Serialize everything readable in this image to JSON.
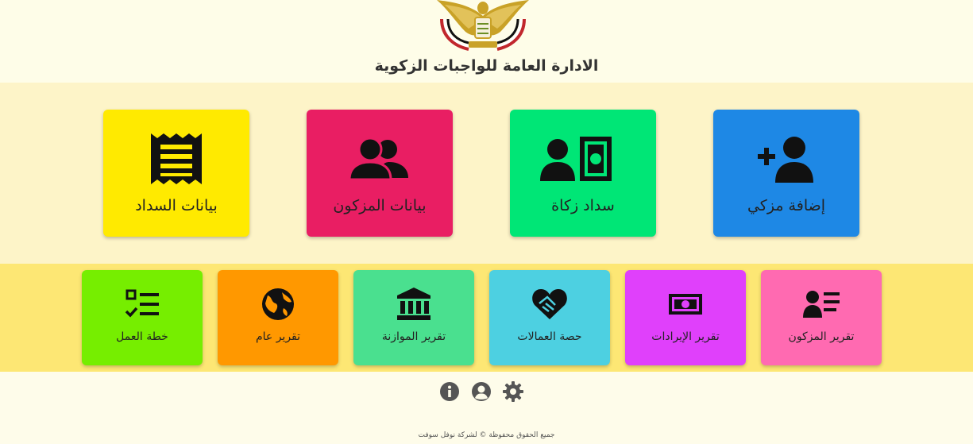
{
  "header": {
    "title": "الادارة العامة للواجبات الزكوية"
  },
  "main_tiles": [
    {
      "label": "إضافة مزكي",
      "icon": "user-plus-icon",
      "color": "#1e88e5"
    },
    {
      "label": "سداد زكاة",
      "icon": "user-money-icon",
      "color": "#00e676"
    },
    {
      "label": "بيانات المزكون",
      "icon": "users-icon",
      "color": "#e91e63"
    },
    {
      "label": "بيانات السداد",
      "icon": "receipt-icon",
      "color": "#ffea00"
    }
  ],
  "report_tiles": [
    {
      "label": "تقرير المزكون",
      "icon": "address-card-icon",
      "color": "#ff6ab1"
    },
    {
      "label": "تقرير الإيرادات",
      "icon": "money-bill-icon",
      "color": "#e040fb"
    },
    {
      "label": "حصة العمالات",
      "icon": "handshake-heart-icon",
      "color": "#4dd0e1"
    },
    {
      "label": "تقرير الموازنة",
      "icon": "bank-icon",
      "color": "#4ae08f"
    },
    {
      "label": "تقرير عام",
      "icon": "globe-icon",
      "color": "#ff9800"
    },
    {
      "label": "خطة العمل",
      "icon": "tasks-icon",
      "color": "#76ee00"
    }
  ],
  "footer": {
    "icons": [
      "info-icon",
      "user-circle-icon",
      "gear-icon"
    ],
    "copyright": "جميع الحقوق محفوظة © لشركة نوفل سوفت"
  }
}
